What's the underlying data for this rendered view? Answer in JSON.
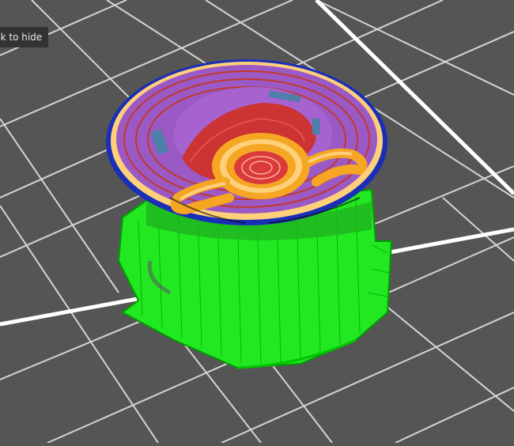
{
  "tooltip": {
    "text": "ck to hide"
  },
  "colors": {
    "background": "#555555",
    "grid_minor": "#d8d8d8",
    "grid_major": "#ffffff",
    "support": "#00dd00",
    "support_dark": "#009900",
    "perimeter_outer": "#f5a623",
    "perimeter_inner": "#ffd07a",
    "infill": "#cc3333",
    "solid_infill": "#9b59c6",
    "bridge": "#4d7fa8",
    "skirt": "#1a2fb8"
  },
  "icons": [
    "print-preview-model"
  ]
}
